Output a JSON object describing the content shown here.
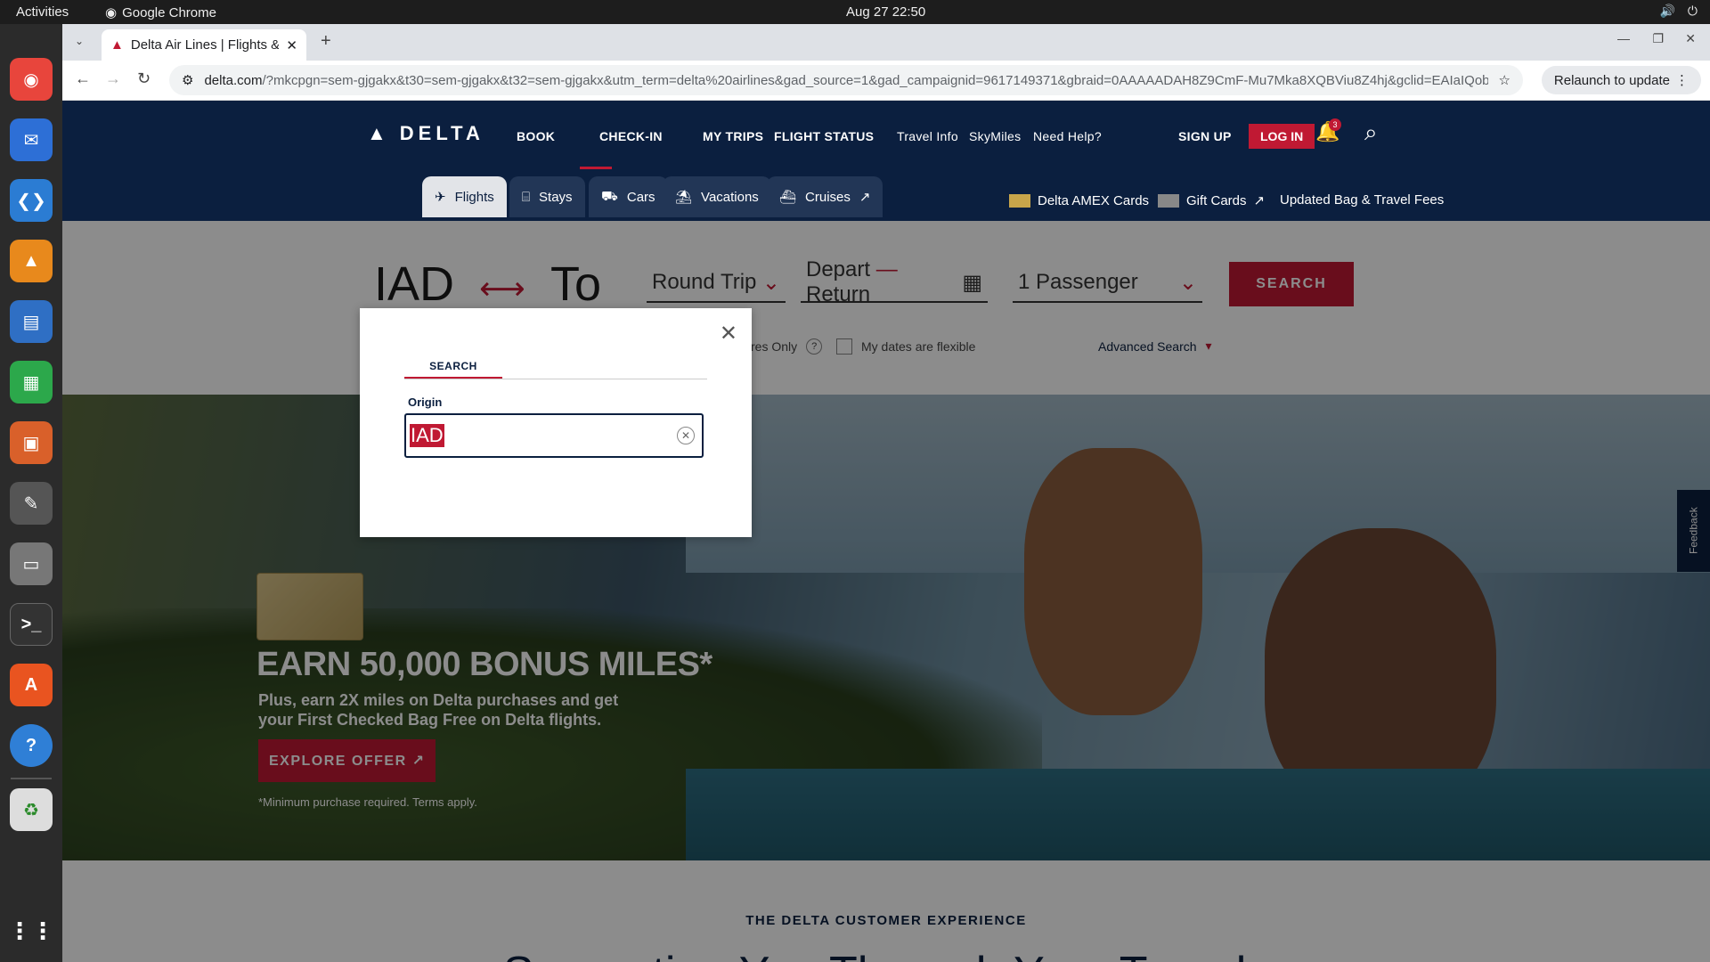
{
  "os": {
    "activities": "Activities",
    "app_name": "Google Chrome",
    "clock": "Aug 27  22:50"
  },
  "browser": {
    "tab_title": "Delta Air Lines | Flights &",
    "url_host": "delta.com",
    "url_rest": "/?mkcpgn=sem-gjgakx&t30=sem-gjgakx&t32=sem-gjgakx&utm_term=delta%20airlines&gad_source=1&gad_campaignid=9617149371&gbraid=0AAAAADAH8Z9CmF-Mu7Mka8XQBViu8Z4hj&gclid=EAIaIQobC...",
    "relaunch": "Relaunch to update"
  },
  "nav": {
    "logo": "DELTA",
    "book": "BOOK",
    "checkin": "CHECK-IN",
    "mytrips": "MY TRIPS",
    "flightstatus": "FLIGHT STATUS",
    "travelinfo": "Travel Info",
    "skymiles": "SkyMiles",
    "needhelp": "Need Help?",
    "signup": "SIGN UP",
    "login": "LOG IN",
    "notif_count": "3"
  },
  "subnav": {
    "flights": "Flights",
    "stays": "Stays",
    "cars": "Cars",
    "vacations": "Vacations",
    "cruises": "Cruises",
    "amex": "Delta AMEX Cards",
    "gift": "Gift Cards",
    "bagfees": "Updated Bag & Travel Fees"
  },
  "search": {
    "origin": "IAD",
    "destination": "To",
    "trip_type": "Round Trip",
    "depart": "Depart",
    "return": "Return",
    "passengers": "1 Passenger",
    "button": "SEARCH",
    "refundable": "res Only",
    "flexible": "My dates are flexible",
    "advanced": "Advanced Search"
  },
  "modal": {
    "tab": "SEARCH",
    "label": "Origin",
    "value": "IAD"
  },
  "hero": {
    "headline": "EARN 50,000 BONUS MILES*",
    "sub": "Plus, earn 2X miles on Delta purchases and get your First Checked Bag Free on Delta flights.",
    "cta": "EXPLORE OFFER ↗",
    "fine": "*Minimum purchase required. Terms apply.",
    "feedback": "Feedback"
  },
  "section": {
    "label": "THE DELTA CUSTOMER EXPERIENCE",
    "title": "Supporting You Through Your Travels"
  }
}
